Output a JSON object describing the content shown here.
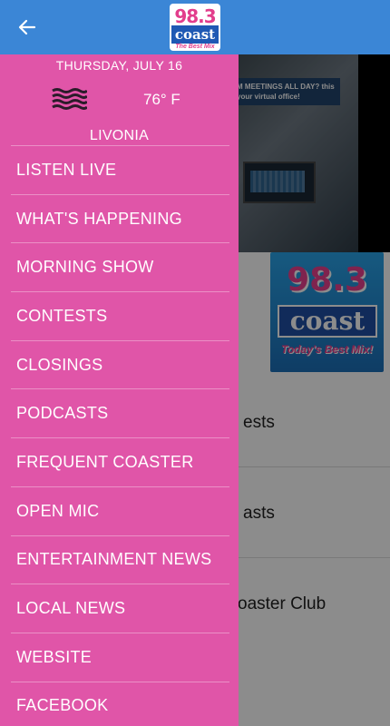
{
  "appbar": {
    "back_icon": "arrow-left-icon",
    "logo": {
      "number": "98.3",
      "brand": "coast",
      "tagline": "The Best Mix"
    }
  },
  "background": {
    "hero_banner": "M MEETINGS ALL DAY? this your virtual office!",
    "thumb": {
      "number": "98.3",
      "brand": "coast",
      "tagline": "Today's Best Mix!"
    },
    "list": [
      "ests",
      "asts",
      "oaster Club"
    ]
  },
  "drawer": {
    "date": "THURSDAY, JULY 16",
    "weather_icon": "haze-icon",
    "temperature": "76° F",
    "city": "LIVONIA",
    "menu": [
      "LISTEN LIVE",
      "WHAT'S HAPPENING",
      "MORNING SHOW",
      "CONTESTS",
      "CLOSINGS",
      "PODCASTS",
      "FREQUENT COASTER",
      "OPEN MIC",
      "ENTERTAINMENT NEWS",
      "LOCAL NEWS",
      "WEBSITE",
      "FACEBOOK"
    ]
  },
  "colors": {
    "appbar": "#3b86d6",
    "drawer": "#e055a8",
    "logo_pink": "#e23d8c",
    "logo_blue": "#1f59b4"
  }
}
